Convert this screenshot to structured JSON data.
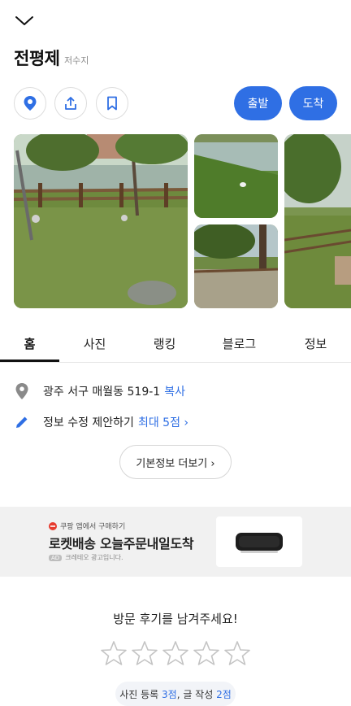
{
  "header": {
    "title": "전평제",
    "subtitle": "저수지"
  },
  "actions": {
    "depart_label": "출발",
    "arrive_label": "도착"
  },
  "tabs": [
    {
      "label": "홈",
      "active": true
    },
    {
      "label": "사진",
      "active": false
    },
    {
      "label": "랭킹",
      "active": false
    },
    {
      "label": "블로그",
      "active": false
    },
    {
      "label": "정보",
      "active": false
    }
  ],
  "info": {
    "address": "광주 서구 매월동 519-1",
    "copy_label": "복사",
    "edit_suggest": "정보 수정 제안하기",
    "edit_reward": "최대 5점 ›",
    "more_label": "기본정보 더보기 ›"
  },
  "ad": {
    "top_text": "쿠팡 앱에서 구매하기",
    "headline": "로켓배송 오늘주문내일도착",
    "badge": "AD",
    "footer": "크레테오 광고입니다."
  },
  "review": {
    "prompt": "방문 후기를 남겨주세요!",
    "chip_prefix": "사진 등록",
    "chip_points_1": "3점",
    "chip_mid": ", 글 작성",
    "chip_points_2": "2점"
  },
  "colors": {
    "accent": "#2f6fe4",
    "ad_bg": "#f1f1f1"
  }
}
